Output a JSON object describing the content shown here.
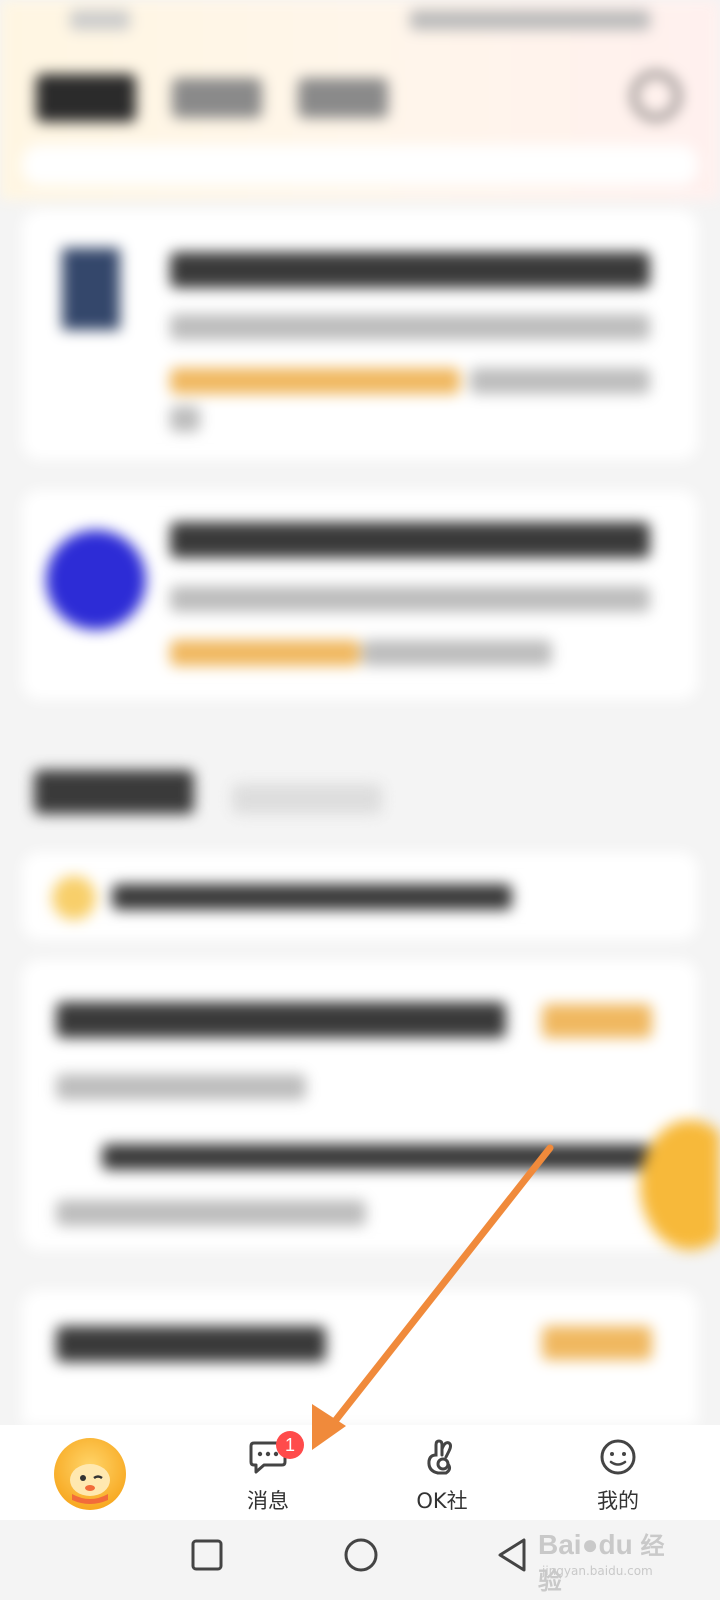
{
  "tabbar": {
    "badge_count": "1",
    "items": [
      {
        "label": ""
      },
      {
        "label": "消息"
      },
      {
        "label": "OK社"
      },
      {
        "label": "我的"
      }
    ]
  },
  "watermark": {
    "brand": "Bai",
    "brand2": "du",
    "cn": "经验",
    "url": "jingyan.baidu.com"
  },
  "colors": {
    "accent_orange": "#f08a3b",
    "badge_red": "#ff4b4b",
    "brand_yellow": "#f7b93a"
  },
  "icons": {
    "home": "home-avatar-icon",
    "messages": "chat-bubble-icon",
    "ok": "ok-hand-icon",
    "profile": "smiley-face-icon",
    "nav_recent": "square-icon",
    "nav_home": "circle-icon",
    "nav_back": "triangle-back-icon"
  }
}
